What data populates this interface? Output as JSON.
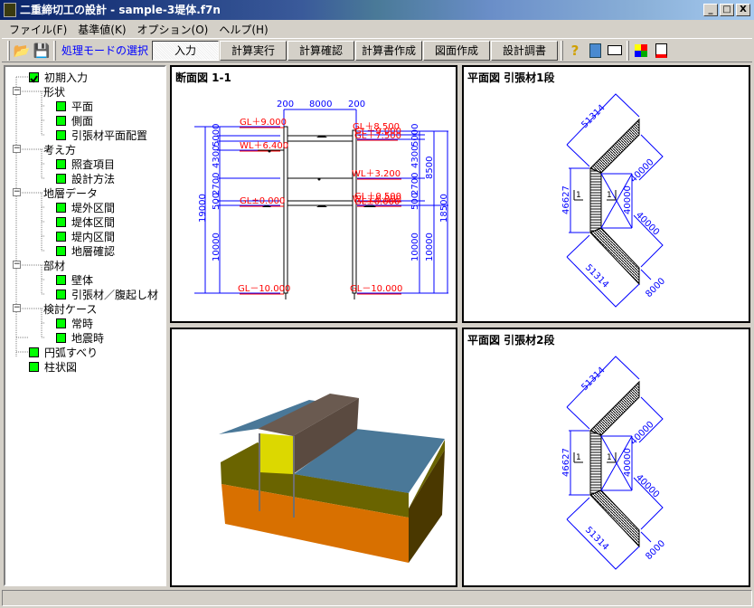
{
  "window": {
    "title": "二重締切工の設計 - sample-3堤体.f7n",
    "min": "_",
    "max": "□",
    "close": "X"
  },
  "menu": [
    "ファイル(F)",
    "基準値(K)",
    "オプション(O)",
    "ヘルプ(H)"
  ],
  "toolbar": {
    "mode_label": "処理モードの選択",
    "modes": [
      "入力",
      "計算実行",
      "計算確認",
      "計算書作成",
      "図面作成",
      "設計調書"
    ]
  },
  "tree": [
    {
      "label": "初期入力",
      "checked": true
    },
    {
      "label": "形状"
    },
    {
      "label": "平面"
    },
    {
      "label": "側面"
    },
    {
      "label": "引張材平面配置"
    },
    {
      "label": "考え方"
    },
    {
      "label": "照査項目"
    },
    {
      "label": "設計方法"
    },
    {
      "label": "地層データ"
    },
    {
      "label": "堤外区間"
    },
    {
      "label": "堤体区間"
    },
    {
      "label": "堤内区間"
    },
    {
      "label": "地層確認"
    },
    {
      "label": "部材"
    },
    {
      "label": "壁体"
    },
    {
      "label": "引張材／腹起し材"
    },
    {
      "label": "検討ケース"
    },
    {
      "label": "常時"
    },
    {
      "label": "地震時"
    },
    {
      "label": "円弧すべり"
    },
    {
      "label": "柱状図"
    }
  ],
  "section": {
    "title": "断面図 1-1",
    "top_dims": [
      "200",
      "8000",
      "200"
    ],
    "left_levels": [
      "GL＋9.000",
      "WL＋6.400",
      "GL±0.000",
      "GL－10.000"
    ],
    "right_levels": [
      "GL＋8.500",
      "GL＋9.000",
      "GL＋7.500",
      "WL＋3.200",
      "GL＋0.500",
      "WL＋6.000",
      "GL±0.000",
      "GL－10.000"
    ],
    "left_dims": [
      "19000",
      "10000",
      "500",
      "2700",
      "4300",
      "5000"
    ],
    "right_dims": [
      "18500",
      "8500",
      "10000",
      "10000",
      "4300",
      "5000",
      "500",
      "2700"
    ]
  },
  "plan1": {
    "title": "平面図 引張材1段",
    "dims": [
      "51314",
      "40000",
      "46627",
      "40000",
      "40000",
      "51314",
      "8000"
    ],
    "marks": [
      "1",
      "1"
    ]
  },
  "plan2": {
    "title": "平面図 引張材2段",
    "dims": [
      "51314",
      "40000",
      "46627",
      "40000",
      "40000",
      "51314",
      "8000"
    ],
    "marks": [
      "1",
      "1"
    ]
  },
  "colors": {
    "dim": "#0000ff",
    "level": "#ff0000"
  }
}
